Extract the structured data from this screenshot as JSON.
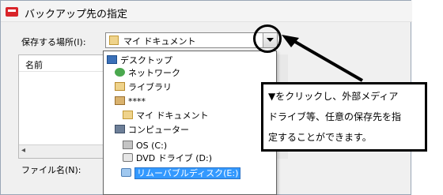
{
  "window": {
    "title": "バックアップ先の指定"
  },
  "save_location": {
    "label": "保存する場所(I):",
    "value": "マイ ドキュメント"
  },
  "file_list": {
    "column_name": "名前"
  },
  "file_name": {
    "label": "ファイル名(N):"
  },
  "dropdown": {
    "items": [
      {
        "icon": "desktop-icon",
        "label": "デスクトップ"
      },
      {
        "icon": "network-icon",
        "label": "ネットワーク"
      },
      {
        "icon": "library-icon",
        "label": "ライブラリ"
      },
      {
        "icon": "user-folder-icon",
        "label": "****"
      },
      {
        "icon": "folder-icon",
        "label": "マイ ドキュメント"
      },
      {
        "icon": "computer-icon",
        "label": "コンピューター"
      },
      {
        "icon": "drive-icon",
        "label": "OS (C:)"
      },
      {
        "icon": "dvd-drive-icon",
        "label": "DVD ドライブ (D:)"
      },
      {
        "icon": "removable-disk-icon",
        "label": "リムーバブルディスク(E:)",
        "selected": true
      }
    ]
  },
  "callout": {
    "lines": [
      "▼をクリックし、外部メディア",
      "ドライブ等、任意の保存先を指",
      "定することができます。"
    ]
  }
}
